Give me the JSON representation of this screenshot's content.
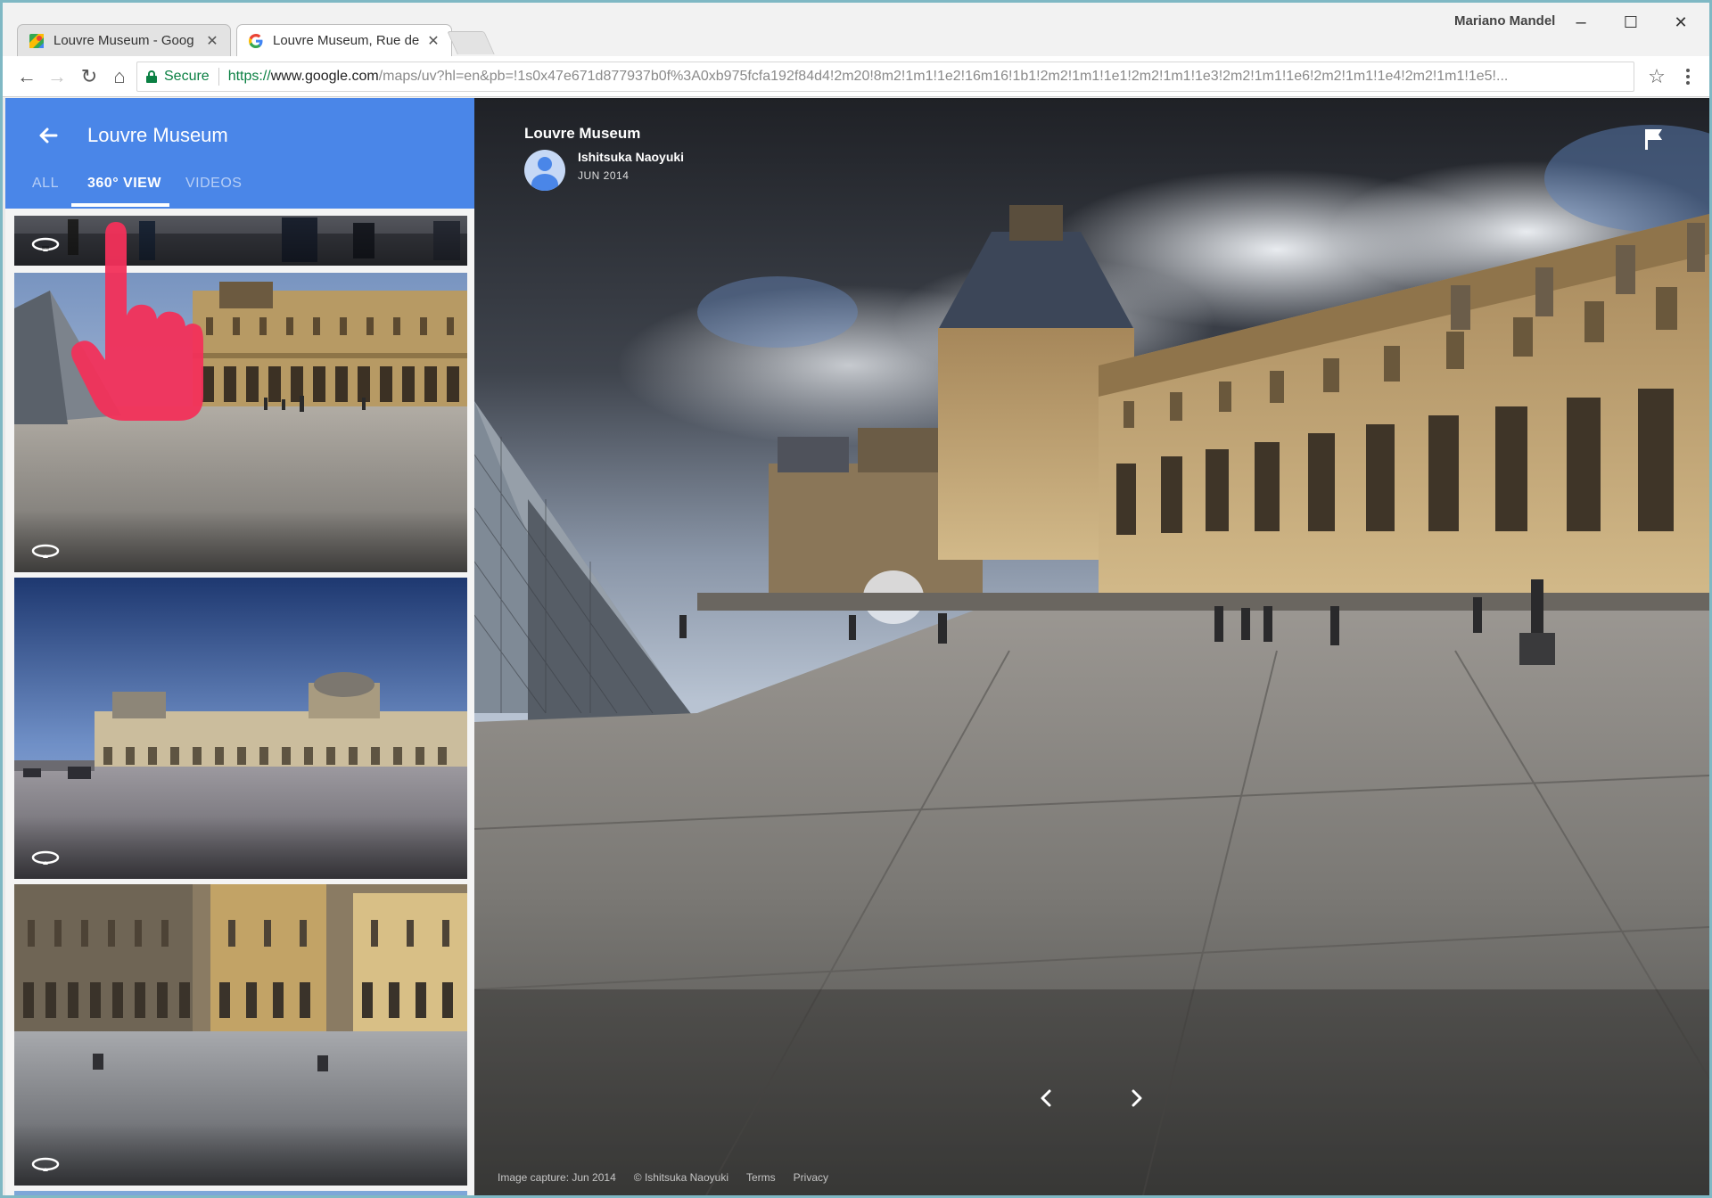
{
  "window": {
    "user_name": "Mariano Mandel",
    "minimize_glyph": "–",
    "maximize_glyph": "☐",
    "close_glyph": "✕"
  },
  "tabs": [
    {
      "title": "Louvre Museum - Goog",
      "icon": "google-maps-icon",
      "close": "✕"
    },
    {
      "title": "Louvre Museum, Rue de",
      "icon": "google-icon",
      "close": "✕"
    }
  ],
  "toolbar": {
    "back_glyph": "←",
    "forward_glyph": "→",
    "reload_glyph": "↻",
    "home_glyph": "⌂",
    "secure_label": "Secure",
    "url_scheme": "https://",
    "url_host": "www.google.com",
    "url_rest": "/maps/uv?hl=en&pb=!1s0x47e671d877937b0f%3A0xb975fcfa192f84d4!2m20!8m2!1m1!1e2!16m16!1b1!2m2!1m1!1e1!2m2!1m1!1e3!2m2!1m1!1e6!2m2!1m1!1e4!2m2!1m1!1e5!...",
    "star_glyph": "☆"
  },
  "panel": {
    "title": "Louvre Museum",
    "tabs": [
      "ALL",
      "360° VIEW",
      "VIDEOS"
    ],
    "active_tab": 1,
    "accent_color": "#4a86e8"
  },
  "viewer": {
    "place_name": "Louvre Museum",
    "author": "Ishitsuka Naoyuki",
    "date": "JUN 2014",
    "collapse_glyph": "◂",
    "footer": [
      "Image capture: Jun 2014",
      "© Ishitsuka Naoyuki",
      "Terms",
      "Privacy"
    ]
  }
}
